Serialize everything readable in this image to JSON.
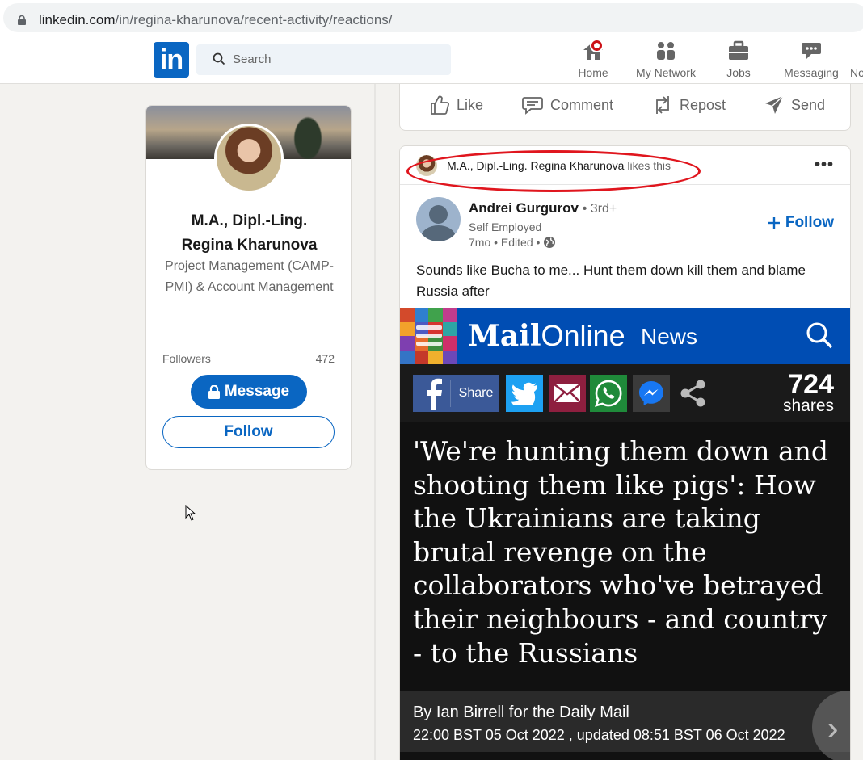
{
  "browser": {
    "url_host": "linkedin.com",
    "url_path": "/in/regina-kharunova/recent-activity/reactions/"
  },
  "nav": {
    "search_placeholder": "Search",
    "items": [
      {
        "label": "Home",
        "icon": "home-icon"
      },
      {
        "label": "My Network",
        "icon": "network-icon"
      },
      {
        "label": "Jobs",
        "icon": "briefcase-icon"
      },
      {
        "label": "Messaging",
        "icon": "messaging-icon"
      },
      {
        "label": "No"
      }
    ]
  },
  "profile": {
    "name_line1": "M.A., Dipl.-Ling.",
    "name_line2": "Regina Kharunova",
    "title": "Project Management (CAMP-PMI) & Account Management",
    "followers_label": "Followers",
    "followers_count": "472",
    "message_label": "Message",
    "follow_label": "Follow"
  },
  "actions": {
    "like": "Like",
    "comment": "Comment",
    "repost": "Repost",
    "send": "Send"
  },
  "post": {
    "liker_name": "M.A., Dipl.-Ling. Regina Kharunova",
    "liker_suffix": "likes this",
    "author_name": "Andrei Gurgurov",
    "author_degree": "• 3rd+",
    "author_headline": "Self Employed",
    "author_time": "7mo • Edited •",
    "follow_label": "Follow",
    "text": "Sounds like Bucha to me... Hunt them down kill them and blame Russia after"
  },
  "article": {
    "logo_mail": "Mail",
    "logo_online": "Online",
    "section": "News",
    "share_label": "Share",
    "shares_count": "724",
    "shares_label": "shares",
    "headline": "'We're hunting them down and shooting them like pigs': How the Ukrainians are taking brutal revenge on the collaborators who've betrayed their neighbours - and country - to the Russians",
    "byline": "By Ian Birrell for the Daily Mail",
    "dateline": "22:00 BST 05 Oct 2022 , updated 08:51 BST 06 Oct 2022"
  },
  "colors": {
    "linkedin_blue": "#0a66c2",
    "mail_blue": "#004db3",
    "highlight_red": "#e0161e"
  }
}
